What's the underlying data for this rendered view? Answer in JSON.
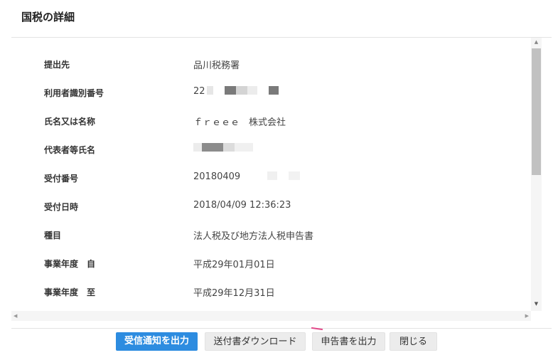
{
  "dialog": {
    "title": "国税の詳細"
  },
  "details": [
    {
      "label": "提出先",
      "value": "品川税務署"
    },
    {
      "label": "利用者識別番号",
      "value": "22"
    },
    {
      "label": "氏名又は名称",
      "value": "ｆｒｅｅｅ　株式会社"
    },
    {
      "label": "代表者等氏名",
      "value": ""
    },
    {
      "label": "受付番号",
      "value": "20180409"
    },
    {
      "label": "受付日時",
      "value": "2018/04/09 12:36:23"
    },
    {
      "label": "種目",
      "value": "法人税及び地方法人税申告書"
    },
    {
      "label": "事業年度　自",
      "value": "平成29年01月01日"
    },
    {
      "label": "事業年度　至",
      "value": "平成29年12月31日"
    }
  ],
  "buttons": {
    "receipt": "受信通知を出力",
    "download": "送付書ダウンロード",
    "declaration": "申告書を出力",
    "close": "閉じる"
  },
  "colors": {
    "primary": "#2d8ce0",
    "accent": "#e24a8a"
  },
  "icons": {
    "scroll_up": "scroll-up-arrow",
    "scroll_down": "scroll-down-arrow",
    "scroll_left": "scroll-left-arrow",
    "scroll_right": "scroll-right-arrow"
  }
}
